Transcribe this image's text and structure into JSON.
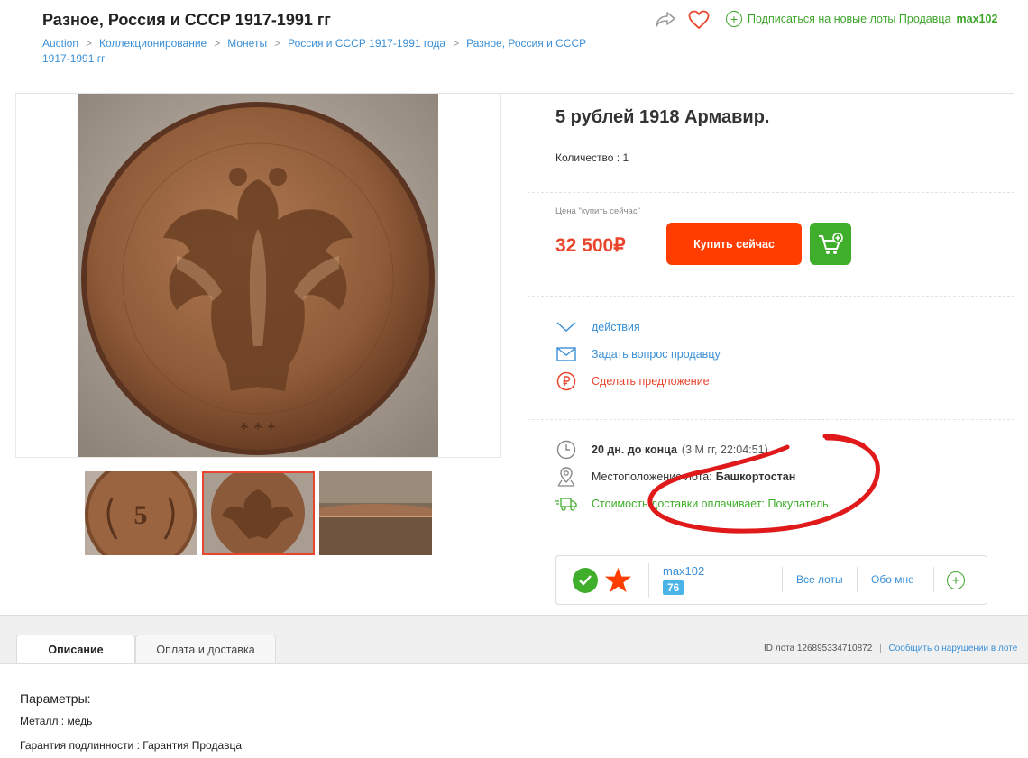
{
  "header": {
    "title": "Разное, Россия и СССР 1917-1991 гг",
    "breadcrumb": [
      "Auction",
      "Коллекционирование",
      "Монеты",
      "Россия и СССР 1917-1991 года",
      "Разное, Россия и СССР"
    ],
    "breadcrumb_tail": "1917-1991 гг",
    "subscribe_label": "Подписаться на новые лоты Продавца",
    "seller_name": "max102"
  },
  "lot": {
    "title": "5 рублей 1918 Армавир.",
    "quantity": "Количество : 1",
    "price_label": "Цена \"купить сейчас\"",
    "price": "32 500₽",
    "buy_label": "Купить сейчас"
  },
  "actions": {
    "more": "действия",
    "ask": "Задать вопрос продавцу",
    "offer": "Сделать предложение"
  },
  "info": {
    "time_bold": "20 дн. до конца",
    "time_rest": "(3 М    гг, 22:04:51)",
    "location_label": "Местоположение лота:",
    "location_value": "Башкортостан",
    "shipping": "Стоимость доставки оплачивает: Покупатель"
  },
  "seller": {
    "name": "max102",
    "rating": "76",
    "all_lots": "Все лоты",
    "about": "Обо мне"
  },
  "tabs": {
    "description": "Описание",
    "payment": "Оплата и доставка"
  },
  "footer": {
    "lot_id": "ID лота 126895334710872",
    "report": "Сообщить о нарушении в лоте"
  },
  "params": {
    "title": "Параметры:",
    "metal": "Металл : медь",
    "guarantee": "Гарантия подлинности : Гарантия Продавца"
  },
  "colors": {
    "accent_red": "#ff3d00",
    "price_red": "#e8452c",
    "green": "#3fae2a",
    "link_blue": "#3a8fd6"
  },
  "coin_images": {
    "main": "coin-reverse-eagle-image",
    "thumb_1": "coin-obverse-5-rubles-image",
    "thumb_2": "coin-reverse-eagle-image",
    "thumb_3": "coin-edge-image"
  }
}
